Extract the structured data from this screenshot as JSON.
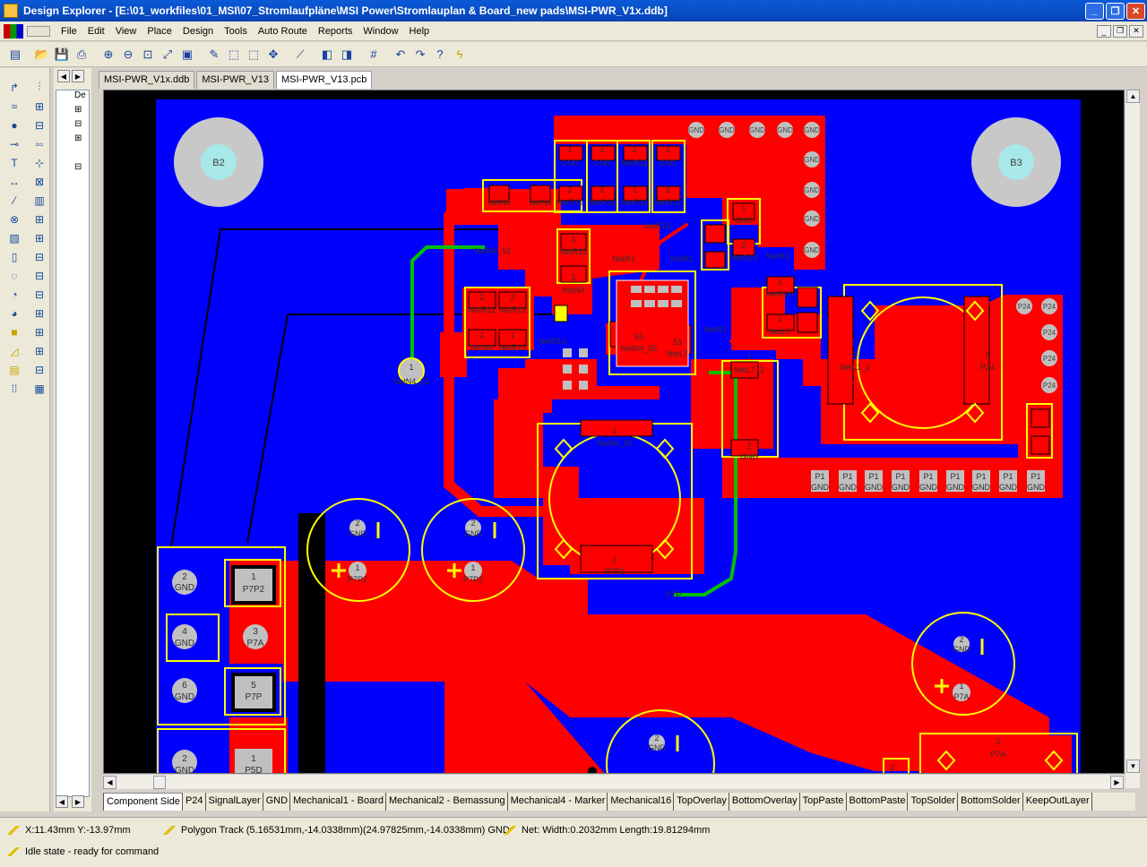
{
  "window": {
    "title": "Design Explorer - [E:\\01_workfiles\\01_MSI\\07_Stromlaufpläne\\MSI Power\\Stromlauplan & Board_new pads\\MSI-PWR_V1x.ddb]"
  },
  "menu": {
    "items": [
      "File",
      "Edit",
      "View",
      "Place",
      "Design",
      "Tools",
      "Auto Route",
      "Reports",
      "Window",
      "Help"
    ]
  },
  "tree": {
    "root_label": "De"
  },
  "doc_tabs": [
    "MSI-PWR_V1x.ddb",
    "MSI-PWR_V13",
    "MSI-PWR_V13.pcb"
  ],
  "layer_tabs": [
    "Component Side",
    "P24",
    "SignalLayer",
    "GND",
    "Mechanical1 - Board",
    "Mechanical2 - Bemassung",
    "Mechanical4 - Marker",
    "Mechanical16",
    "TopOverlay",
    "BottomOverlay",
    "TopPaste",
    "BottomPaste",
    "TopSolder",
    "BottomSolder",
    "KeepOutLayer"
  ],
  "status": {
    "coords": "X:11.43mm Y:-13.97mm",
    "object": "Polygon Track (5.16531mm,-14.0338mm)(24.97825mm,-14.0338mm)  GND",
    "net": "Net: Width:0.2032mm Length:19.81294mm",
    "state": "Idle state - ready for command"
  },
  "pcb": {
    "holes": [
      "B2",
      "B3"
    ],
    "labels": {
      "gnd": "GND",
      "p24": "P24",
      "p1": "P1",
      "p7p2": "P7P2",
      "p7a": "P7A",
      "p7p": "P7P",
      "p5d": "P5D",
      "netn4_52": "NetN4_52",
      "netn4_55": "NetN4_55",
      "netl7_2": "NetL7_2",
      "netl1_2": "NetL1_2",
      "netr1": "NetR1",
      "netr12": "NetR12",
      "netr13": "NetR13",
      "netr10": "NetR10",
      "netr11": "NetR11",
      "netl7": "NetL7",
      "netn4": "NetN4",
      "n55": "55",
      "n53": "53",
      "n1": "1",
      "n2": "2",
      "n3": "3",
      "n4": "4",
      "n5": "5",
      "n6": "6"
    }
  }
}
